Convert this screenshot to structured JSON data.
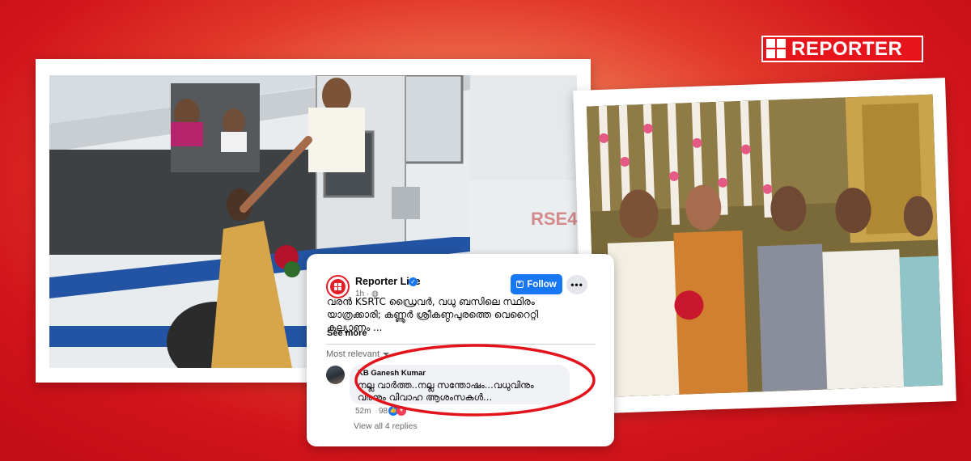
{
  "brand": {
    "logo_text": "REPORTER",
    "logo_color": "#e8141c",
    "background_color": "#d1141b"
  },
  "photos": [
    {
      "label": "bus-photo"
    },
    {
      "label": "wedding-stage-photo"
    }
  ],
  "post": {
    "page_name": "Reporter Live",
    "verified_icon": "check-badge-icon",
    "time": "1h",
    "audience_icon": "globe-icon",
    "follow_label": "Follow",
    "more_label": "•••",
    "text_line1": "വരൻ KSRTC ഡ്രൈവർ, വധു ബസിലെ സ്ഥിരം",
    "text_line2": "യാത്രക്കാരി; കണ്ണൂർ ശ്രീകണ്ഠപുരത്തെ വെറൈറ്റി",
    "text_line3": "കല്യാണം ...",
    "see_more": "See more",
    "accent_color": "#1877f2"
  },
  "comments": {
    "sort_label": "Most relevant",
    "items": [
      {
        "author": "KB Ganesh Kumar",
        "text_line1": "നല്ല വാർത്ത..നല്ല സന്തോഷം...വധുവിനും",
        "text_line2": "വരനും വിവാഹ ആശംസകൾ...",
        "time": "52m",
        "reactions_count": "98",
        "reactions": [
          "like",
          "love"
        ]
      }
    ],
    "view_replies": "View all 4 replies"
  },
  "highlight": {
    "color": "#e3131b"
  }
}
